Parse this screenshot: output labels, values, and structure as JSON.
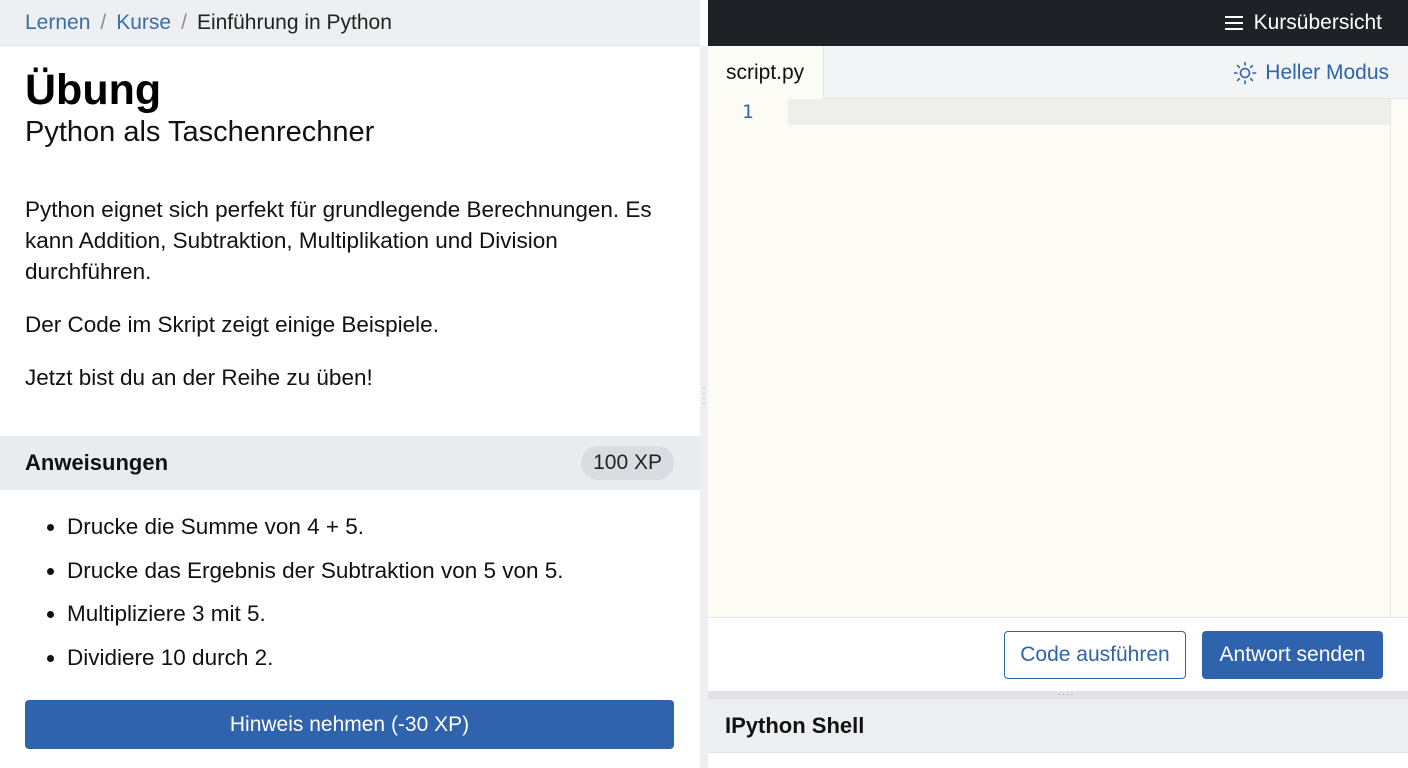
{
  "breadcrumb": {
    "items": [
      "Lernen",
      "Kurse"
    ],
    "separator": "/",
    "current": "Einführung in Python"
  },
  "exercise": {
    "title": "Übung",
    "subtitle": "Python als Taschenrechner",
    "description": [
      "Python eignet sich perfekt für grundlegende Berechnungen. Es kann Addition, Subtraktion, Multiplikation und Division durchführen.",
      "Der Code im Skript zeigt einige Beispiele.",
      "Jetzt bist du an der Reihe zu üben!"
    ]
  },
  "instructions": {
    "title": "Anweisungen",
    "xp": "100 XP",
    "items": [
      "Drucke die Summe von 4 + 5.",
      "Drucke das Ergebnis der Subtraktion von 5 von 5.",
      "Multipliziere 3 mit 5.",
      "Dividiere 10 durch 2."
    ],
    "hint_button": "Hinweis nehmen (-30 XP)"
  },
  "topbar": {
    "course_overview": "Kursübersicht",
    "menu_icon": "hamburger-icon"
  },
  "editor": {
    "tab_label": "script.py",
    "mode_toggle": "Heller Modus",
    "mode_icon": "sun-icon",
    "line_numbers": [
      "1"
    ]
  },
  "actions": {
    "run": "Code ausführen",
    "submit": "Antwort senden"
  },
  "shell": {
    "title": "IPython Shell"
  },
  "colors": {
    "accent": "#2f63ae",
    "topbar_bg": "#1e2126",
    "editor_bg": "#fcfcf5"
  }
}
